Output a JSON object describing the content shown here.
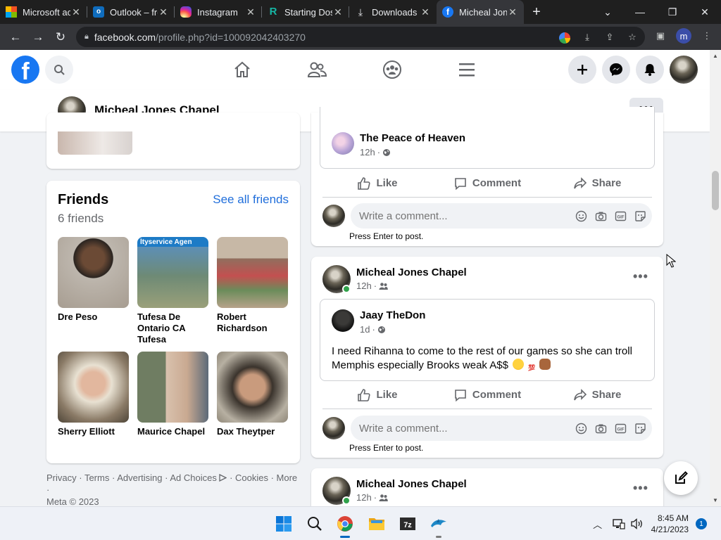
{
  "browser": {
    "tabs": [
      {
        "title": "Microsoft account",
        "icon": "microsoft-icon"
      },
      {
        "title": "Outlook – free",
        "icon": "outlook-icon"
      },
      {
        "title": "Instagram",
        "icon": "instagram-icon"
      },
      {
        "title": "Starting Dosage",
        "icon": "r-site-icon"
      },
      {
        "title": "Downloads",
        "icon": "download-icon"
      },
      {
        "title": "Micheal Jones Chapel",
        "icon": "facebook-icon",
        "active": true
      }
    ],
    "url_host": "facebook.com",
    "url_path": "/profile.php?id=100092042403270",
    "profile_initial": "m"
  },
  "profile": {
    "name": "Micheal Jones Chapel",
    "more_label": "•••"
  },
  "friends": {
    "title": "Friends",
    "count": "6 friends",
    "see_all": "See all friends",
    "items": [
      {
        "name": "Dre Peso"
      },
      {
        "name": "Tufesa De Ontario CA Tufesa"
      },
      {
        "name": "Robert Richardson"
      },
      {
        "name": "Sherry Elliott"
      },
      {
        "name": "Maurice Chapel"
      },
      {
        "name": "Dax Theytper"
      }
    ],
    "banner_text": "ltyservice Agen"
  },
  "footer": {
    "links": [
      "Privacy",
      "Terms",
      "Advertising",
      "Ad Choices",
      "Cookies",
      "More"
    ],
    "copyright": "Meta © 2023"
  },
  "posts": [
    {
      "shared_author": "The Peace of Heaven",
      "shared_time": "12h",
      "shared_privacy": "globe-icon"
    },
    {
      "author": "Micheal Jones Chapel",
      "time": "12h",
      "privacy": "friends-icon",
      "shared_author": "Jaay TheDon",
      "shared_time": "1d",
      "shared_privacy": "globe-icon",
      "text": "I need Rihanna to come to the rest of our games so she can troll Memphis especially Brooks weak A$$"
    },
    {
      "author": "Micheal Jones Chapel",
      "time": "12h",
      "privacy": "friends-icon"
    }
  ],
  "actions": {
    "like": "Like",
    "comment": "Comment",
    "share": "Share"
  },
  "comment_box": {
    "placeholder": "Write a comment...",
    "hint": "Press Enter to post."
  },
  "taskbar": {
    "time": "8:45 AM",
    "date": "4/21/2023",
    "notification_count": "1"
  },
  "colors": {
    "facebook_blue": "#1877f2",
    "link_blue": "#216fdb",
    "online_green": "#31a24c"
  }
}
